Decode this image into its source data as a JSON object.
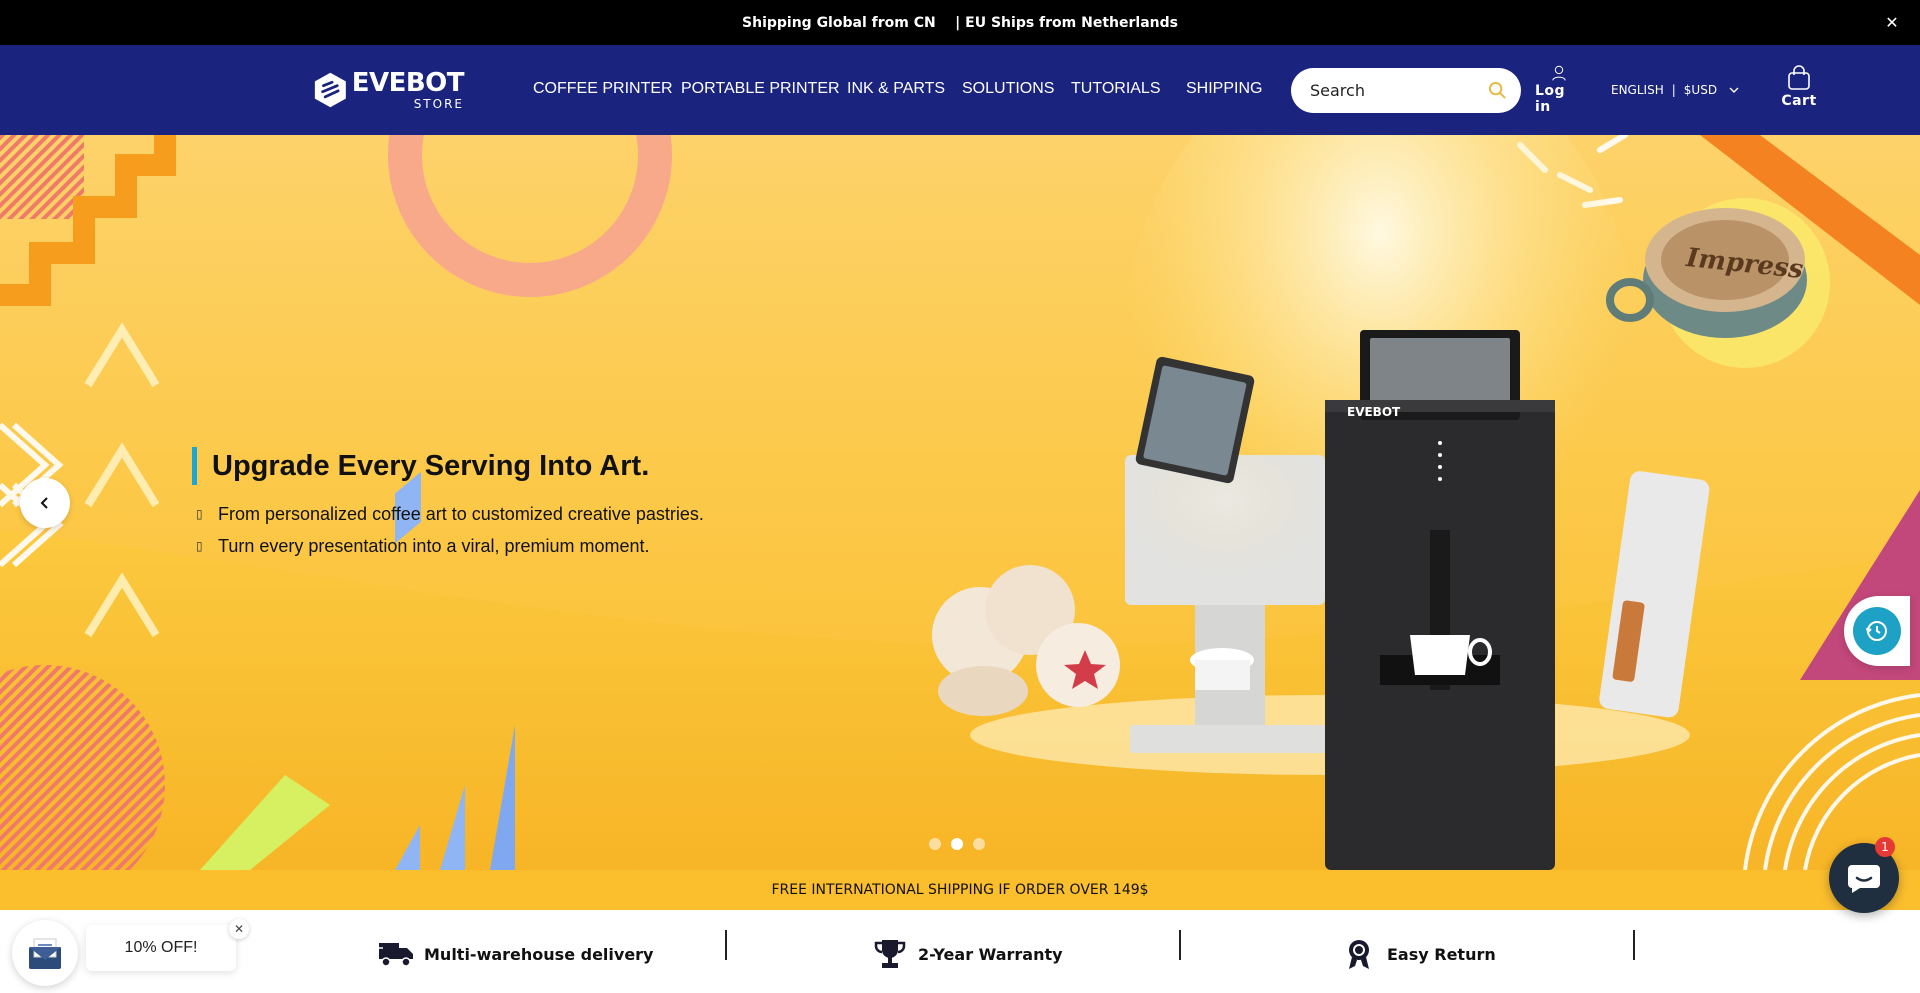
{
  "announcement": {
    "text": "Shipping Global from CN    | EU Ships from Netherlands"
  },
  "brand": {
    "name": "EVEBOT",
    "sub": "STORE"
  },
  "nav": [
    {
      "label": "COFFEE PRINTER"
    },
    {
      "label": "PORTABLE PRINTER"
    },
    {
      "label": "INK & PARTS"
    },
    {
      "label": "SOLUTIONS"
    },
    {
      "label": "TUTORIALS"
    },
    {
      "label": "SHIPPING"
    }
  ],
  "search": {
    "placeholder": "Search"
  },
  "account": {
    "login_label": "Log in"
  },
  "locale": {
    "language": "ENGLISH",
    "separator": "|",
    "currency": "$USD"
  },
  "cart": {
    "label": "Cart"
  },
  "hero": {
    "headline": "Upgrade Every Serving Into Art.",
    "bullets": [
      "From personalized coffee art to customized creative pastries.",
      "Turn every presentation into a viral, premium moment."
    ],
    "machine_brand": "EVEBOT",
    "cup_text": "Impress",
    "slides_total": 3,
    "active_slide": 2
  },
  "shipping_banner": "FREE INTERNATIONAL SHIPPING IF ORDER OVER 149$",
  "features": [
    {
      "label": "Multi-warehouse delivery",
      "icon": "truck-icon"
    },
    {
      "label": "2-Year Warranty",
      "icon": "trophy-icon"
    },
    {
      "label": "Easy Return",
      "icon": "award-ribbon-icon"
    }
  ],
  "promo": {
    "label": "10% OFF!"
  },
  "chat": {
    "badge_count": "1"
  }
}
